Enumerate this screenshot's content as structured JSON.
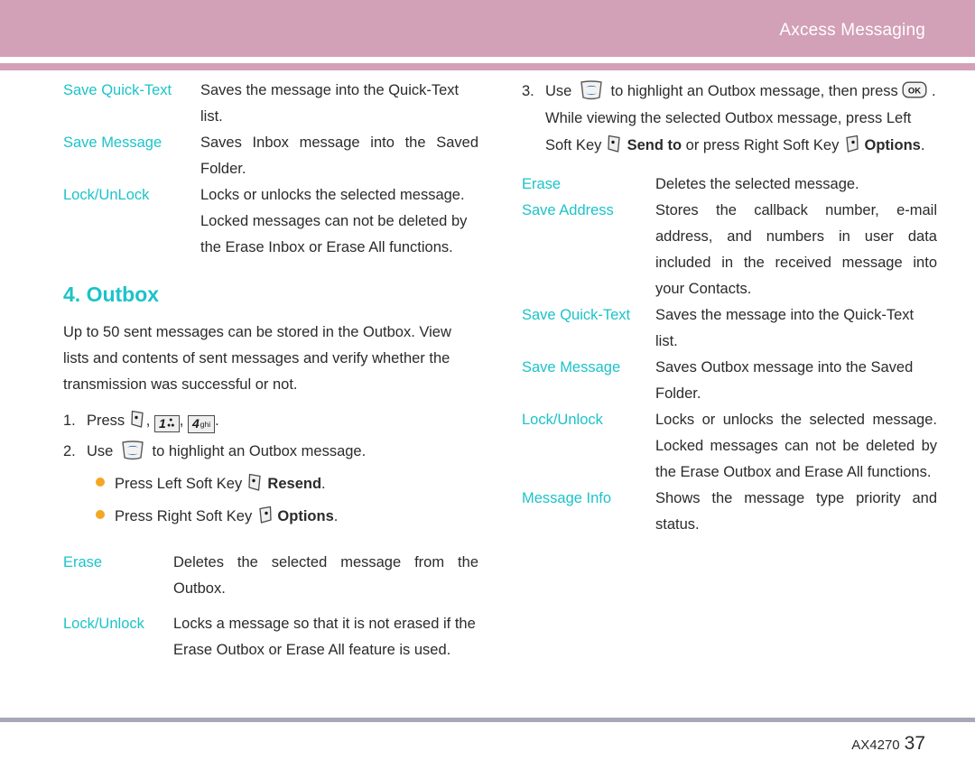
{
  "header": {
    "title": "Axcess Messaging",
    "band_color": "#d2a0b7"
  },
  "theme": {
    "accent_teal": "#1cc3c9",
    "bullet_orange": "#f5a623",
    "text": "#2b2b2b",
    "footer_rule": "#a7a9b8"
  },
  "left_column": {
    "options_list_top": [
      {
        "term": "Save Quick-Text",
        "desc": "Saves the message into the Quick-Text list."
      },
      {
        "term": "Save Message",
        "desc": "Saves Inbox message into the Saved Folder."
      },
      {
        "term": "Lock/UnLock",
        "desc": "Locks or unlocks the selected message. Locked messages can not be deleted by the Erase Inbox or Erase All functions."
      }
    ],
    "section_heading": "4. Outbox",
    "intro_paragraph": "Up to 50 sent messages can be stored in the Outbox. View lists and contents of sent messages and verify whether the transmission was successful or not.",
    "steps": [
      {
        "number": "1.",
        "prefix": "Press",
        "keys": [
          "left-soft-key",
          "key-1",
          "key-4-ghi"
        ],
        "suffix": "."
      },
      {
        "number": "2.",
        "prefix": "Use",
        "keys": [
          "nav-up-down-key"
        ],
        "suffix": "to highlight an Outbox message."
      }
    ],
    "bullets": [
      {
        "pre": "Press Left Soft Key",
        "key": "left-soft-key",
        "bold": "Resend",
        "post": "."
      },
      {
        "pre": "Press Right Soft Key",
        "key": "right-soft-key",
        "bold": "Options",
        "post": "."
      }
    ],
    "options_list_bottom": [
      {
        "term": "Erase",
        "desc": "Deletes the selected message from the Outbox."
      },
      {
        "term": "Lock/Unlock",
        "desc": "Locks a message so that it is not erased if the Erase Outbox or Erase All feature is used."
      }
    ]
  },
  "right_column": {
    "step": {
      "number": "3.",
      "part1": "Use",
      "nav_key": "nav-up-down-key",
      "part2": "to highlight an Outbox message, then press",
      "ok_key": "ok-key",
      "part3": ". While viewing the selected Outbox message, press Left Soft Key",
      "left_soft_key": "left-soft-key",
      "bold1": "Send to",
      "part4": "or press Right Soft Key",
      "right_soft_key": "right-soft-key",
      "bold2": "Options",
      "part5": "."
    },
    "options_list": [
      {
        "term": "Erase",
        "desc": "Deletes the selected message."
      },
      {
        "term": "Save Address",
        "desc": "Stores the callback number, e-mail address, and numbers in user data included in the received message into your Contacts."
      },
      {
        "term": "Save Quick-Text",
        "desc": "Saves the message into the Quick-Text list."
      },
      {
        "term": "Save Message",
        "desc": "Saves Outbox message into the Saved Folder."
      },
      {
        "term": "Lock/Unlock",
        "desc": "Locks or unlocks the selected message. Locked messages can not be deleted by the Erase Outbox and Erase All functions."
      },
      {
        "term": "Message Info",
        "desc": "Shows the message type priority and status."
      }
    ]
  },
  "keys": {
    "ok_label": "OK",
    "key1_digit": "1",
    "key4_digit": "4",
    "key4_letters": "ghi"
  },
  "footer": {
    "model": "AX4270",
    "page": "37"
  }
}
